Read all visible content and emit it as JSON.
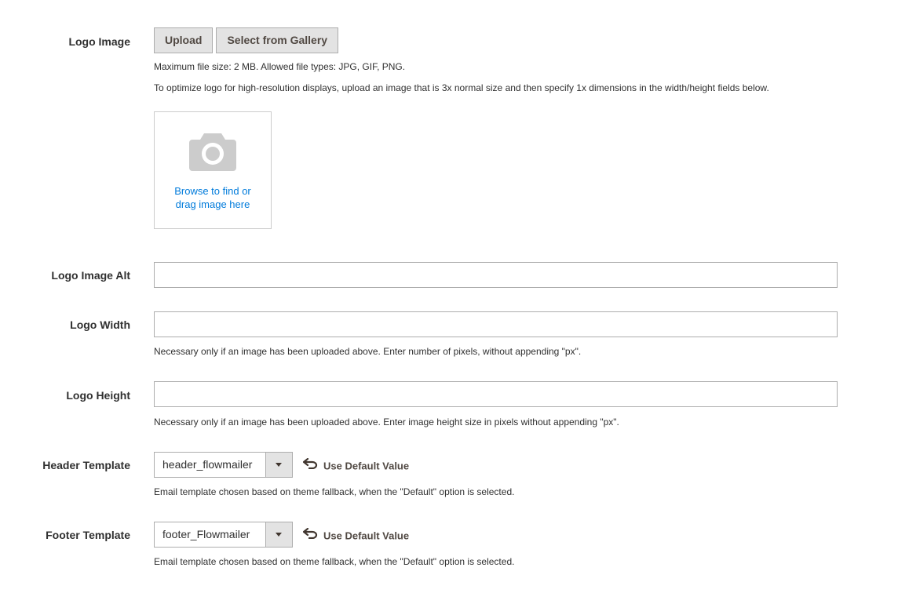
{
  "logo_image": {
    "label": "Logo Image",
    "upload_label": "Upload",
    "gallery_label": "Select from Gallery",
    "note_size": "Maximum file size: 2 MB. Allowed file types: JPG, GIF, PNG.",
    "note_optimize": "To optimize logo for high-resolution displays, upload an image that is 3x normal size and then specify 1x dimensions in the width/height fields below.",
    "dropzone_line1": "Browse to find or",
    "dropzone_line2": "drag image here",
    "camera_icon": "camera-icon"
  },
  "logo_image_alt": {
    "label": "Logo Image Alt",
    "value": ""
  },
  "logo_width": {
    "label": "Logo Width",
    "value": "",
    "note": "Necessary only if an image has been uploaded above. Enter number of pixels, without appending \"px\"."
  },
  "logo_height": {
    "label": "Logo Height",
    "value": "",
    "note": "Necessary only if an image has been uploaded above. Enter image height size in pixels without appending \"px\"."
  },
  "header_template": {
    "label": "Header Template",
    "selected": "header_flowmailer",
    "use_default_label": "Use Default Value",
    "note": "Email template chosen based on theme fallback, when the \"Default\" option is selected."
  },
  "footer_template": {
    "label": "Footer Template",
    "selected": "footer_Flowmailer",
    "use_default_label": "Use Default Value",
    "note": "Email template chosen based on theme fallback, when the \"Default\" option is selected."
  },
  "colors": {
    "link": "#007bdb",
    "button_bg": "#e3e3e3",
    "border": "#adadad",
    "text": "#303030"
  }
}
